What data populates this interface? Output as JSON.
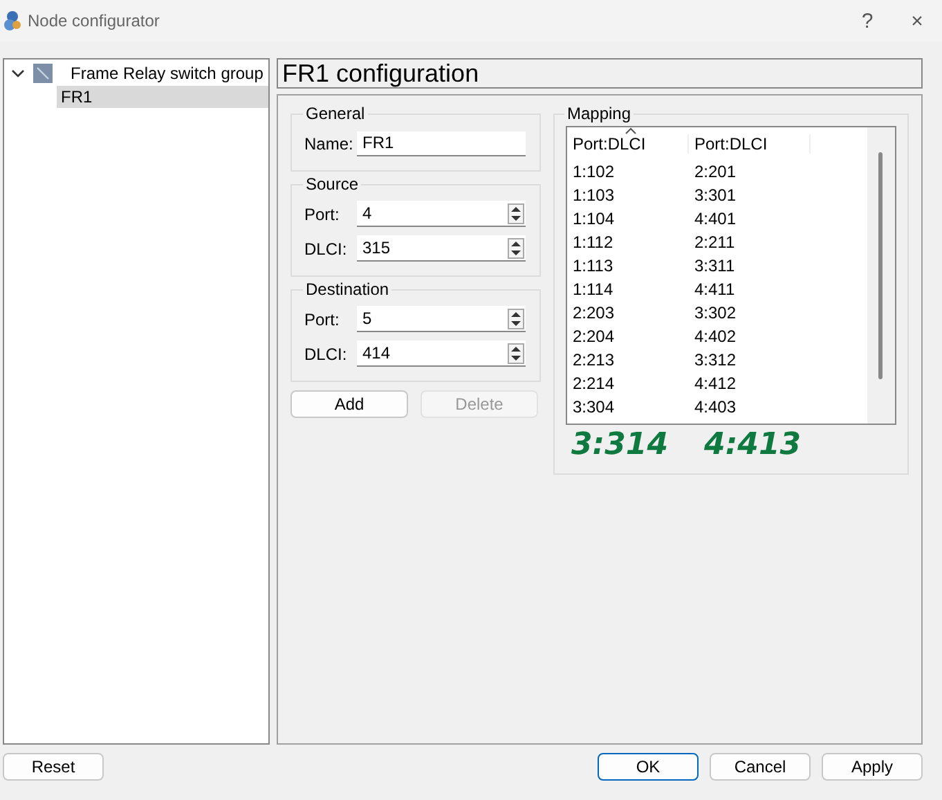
{
  "window": {
    "title": "Node configurator",
    "help": "?",
    "close": "×"
  },
  "tree": [
    {
      "label": "Frame Relay switch group",
      "expanded": true,
      "selected": false,
      "children": [
        {
          "label": "FR1",
          "selected": true
        }
      ]
    }
  ],
  "header": "FR1  configuration",
  "general": {
    "title": "General",
    "name_label": "Name:",
    "name_value": "FR1"
  },
  "source": {
    "title": "Source",
    "port_label": "Port:",
    "port_value": "4",
    "dlci_label": "DLCI:",
    "dlci_value": "315"
  },
  "destination": {
    "title": "Destination",
    "port_label": "Port:",
    "port_value": "5",
    "dlci_label": "DLCI:",
    "dlci_value": "414"
  },
  "actions": [
    {
      "label": "Add",
      "disabled": false
    },
    {
      "label": "Delete",
      "disabled": true
    }
  ],
  "mapping": {
    "title": "Mapping",
    "columns": [
      "Port:DLCI",
      "Port:DLCI"
    ],
    "rows": [
      [
        "1:102",
        "2:201"
      ],
      [
        "1:103",
        "3:301"
      ],
      [
        "1:104",
        "4:401"
      ],
      [
        "1:112",
        "2:211"
      ],
      [
        "1:113",
        "3:311"
      ],
      [
        "1:114",
        "4:411"
      ],
      [
        "2:203",
        "3:302"
      ],
      [
        "2:204",
        "4:402"
      ],
      [
        "2:213",
        "3:312"
      ],
      [
        "2:214",
        "4:412"
      ],
      [
        "3:304",
        "4:403"
      ]
    ]
  },
  "annotations": [
    "3:314",
    "4:413"
  ],
  "footer": {
    "left": "Reset",
    "buttons": [
      {
        "label": "OK",
        "default": true
      },
      {
        "label": "Cancel",
        "default": false
      },
      {
        "label": "Apply",
        "default": false
      }
    ]
  }
}
